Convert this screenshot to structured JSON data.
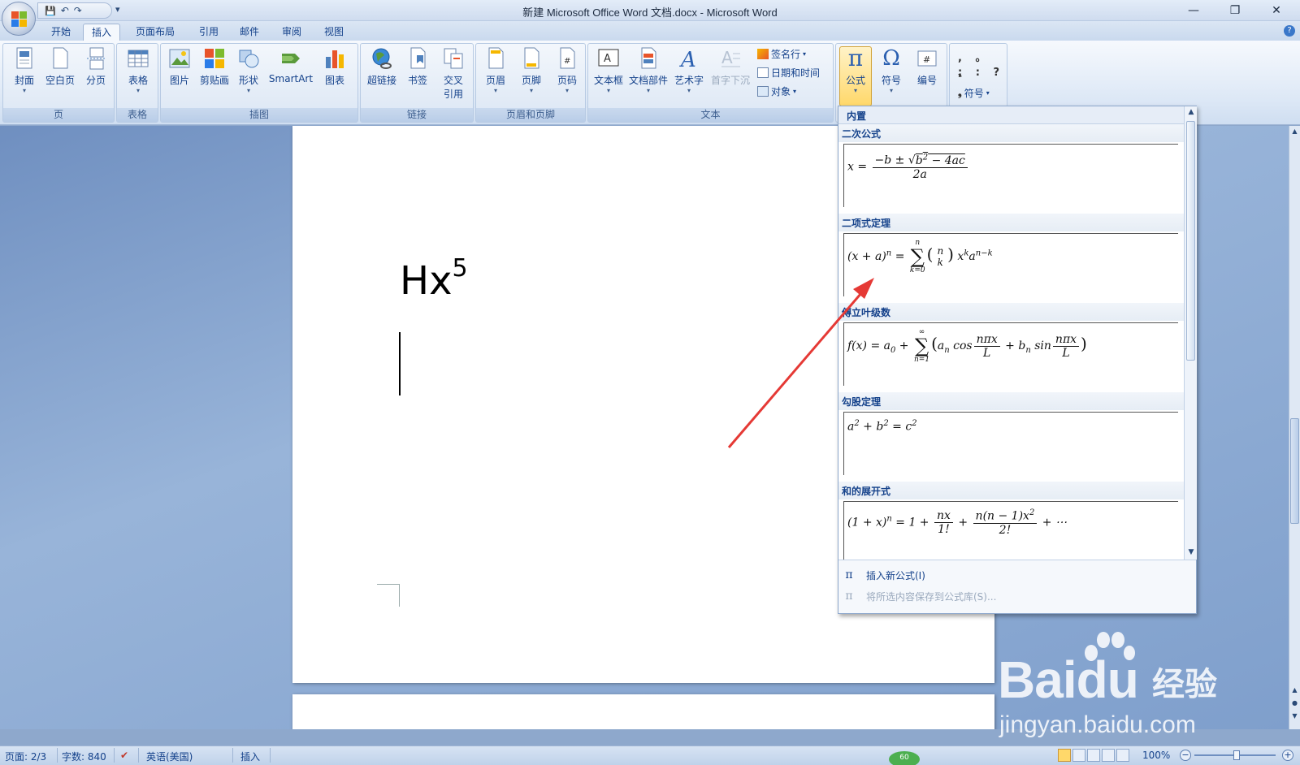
{
  "window": {
    "title": "新建 Microsoft Office Word 文档.docx - Microsoft Word",
    "minimize": "—",
    "restore": "❐",
    "close": "✕"
  },
  "qat": {
    "save": "💾",
    "undo": "↶",
    "redo": "↷",
    "customize": "▾"
  },
  "tabs": [
    {
      "label": "开始"
    },
    {
      "label": "插入"
    },
    {
      "label": "页面布局"
    },
    {
      "label": "引用"
    },
    {
      "label": "邮件"
    },
    {
      "label": "审阅"
    },
    {
      "label": "视图"
    }
  ],
  "ribbon": {
    "groups": {
      "page": {
        "label": "页",
        "cover": "封面",
        "blank": "空白页",
        "break": "分页"
      },
      "table": {
        "label": "表格",
        "table": "表格"
      },
      "illustrations": {
        "label": "插图",
        "picture": "图片",
        "clipart": "剪贴画",
        "shapes": "形状",
        "smartart": "SmartArt",
        "chart": "图表"
      },
      "links": {
        "label": "链接",
        "hyperlink": "超链接",
        "bookmark": "书签",
        "crossref_1": "交叉",
        "crossref_2": "引用"
      },
      "headerfooter": {
        "label": "页眉和页脚",
        "header": "页眉",
        "footer": "页脚",
        "pagenum": "页码"
      },
      "text": {
        "label": "文本",
        "textbox": "文本框",
        "quickparts": "文档部件",
        "wordart": "艺术字",
        "dropcap": "首字下沉",
        "signature": "签名行",
        "datetime": "日期和时间",
        "object": "对象"
      },
      "symbols": {
        "formula": "公式",
        "symbol": "符号",
        "number": "编号"
      },
      "special": {
        "row1": ", 。 、",
        "row2": "; : ?",
        "symbol": "符号"
      }
    }
  },
  "document": {
    "text_base": "Hx",
    "text_sup": "5"
  },
  "gallery": {
    "header": "内置",
    "items": [
      {
        "title": "二次公式"
      },
      {
        "title": "二项式定理"
      },
      {
        "title": "傅立叶级数"
      },
      {
        "title": "勾股定理"
      },
      {
        "title": "和的展开式"
      }
    ],
    "insert_new": "插入新公式(I)",
    "save_selection": "将所选内容保存到公式库(S)...",
    "pi_icon": "π"
  },
  "statusbar": {
    "page": "页面: 2/3",
    "words": "字数: 840",
    "language": "英语(美国)",
    "mode": "插入",
    "zoom": "100%",
    "badge": "60"
  },
  "watermark": {
    "brand": "Bai",
    "brand2": "du",
    "cn": "经验",
    "url": "jingyan.baidu.com"
  },
  "colors": {
    "accent": "#15428b",
    "arrow": "#e53935",
    "highlight": "#ffd86a"
  }
}
